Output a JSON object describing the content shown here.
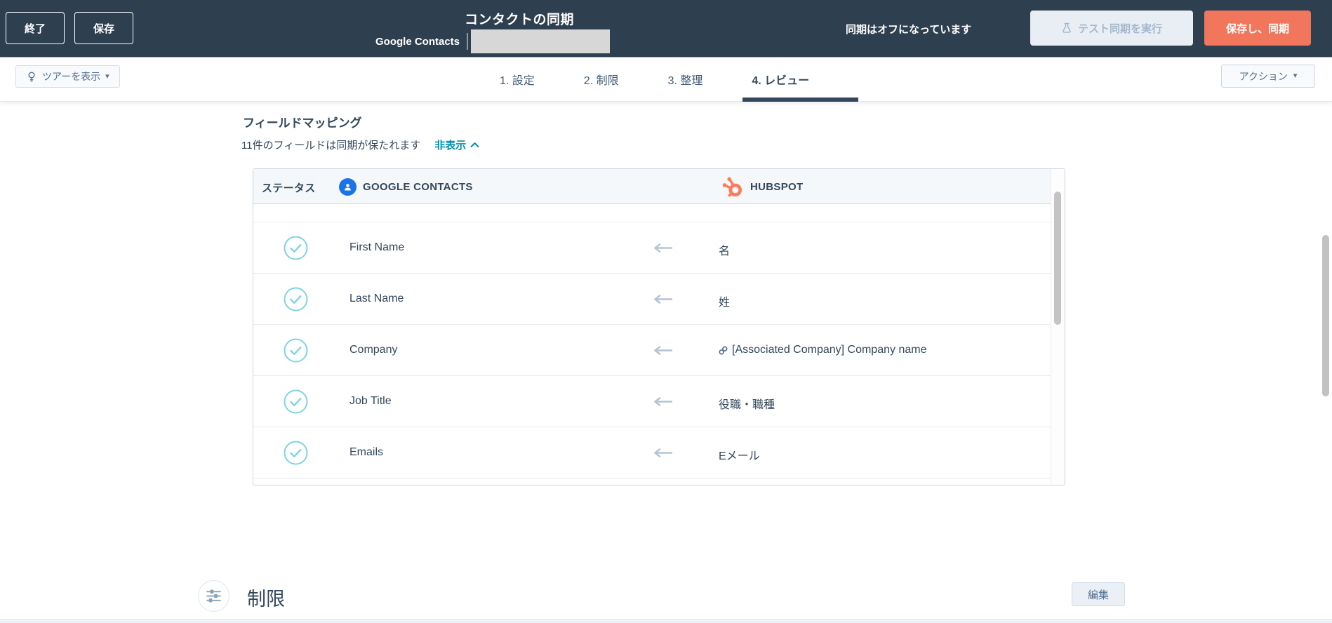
{
  "header": {
    "exit_label": "終了",
    "save_label": "保存",
    "title": "コンタクトの同期",
    "app_name": "Google Contacts",
    "sync_status": "同期はオフになっています",
    "test_sync_label": "テスト同期を実行",
    "save_sync_label": "保存し、同期"
  },
  "toolbar": {
    "tour_label": "ツアーを表示",
    "steps": [
      "1. 設定",
      "2. 制限",
      "3. 整理",
      "4. レビュー"
    ],
    "active_step_index": 3,
    "actions_label": "アクション"
  },
  "mapping": {
    "heading": "フィールドマッピング",
    "summary": "11件のフィールドは同期が保たれます",
    "hide_label": "非表示"
  },
  "table": {
    "headers": {
      "status": "ステータス",
      "google": "GOOGLE CONTACTS",
      "hubspot": "HUBSPOT"
    },
    "rows": [
      {
        "google": "First Name",
        "hubspot": "名",
        "link": false
      },
      {
        "google": "Last Name",
        "hubspot": "姓",
        "link": false
      },
      {
        "google": "Company",
        "hubspot": "[Associated Company] Company name",
        "link": true
      },
      {
        "google": "Job Title",
        "hubspot": "役職・職種",
        "link": false
      },
      {
        "google": "Emails",
        "hubspot": "Eメール",
        "link": false
      }
    ]
  },
  "limits": {
    "heading": "制限",
    "edit_label": "編集"
  },
  "icons": {
    "caret_down": "▾"
  },
  "colors": {
    "header_bg": "#2e3f50",
    "primary_orange": "#f2765c",
    "hubspot_logo_orange": "#ff7a59",
    "google_blue": "#1a73e8",
    "link_teal": "#0091ae",
    "check_cyan": "#7ed4e2",
    "text_dark": "#33475b"
  }
}
